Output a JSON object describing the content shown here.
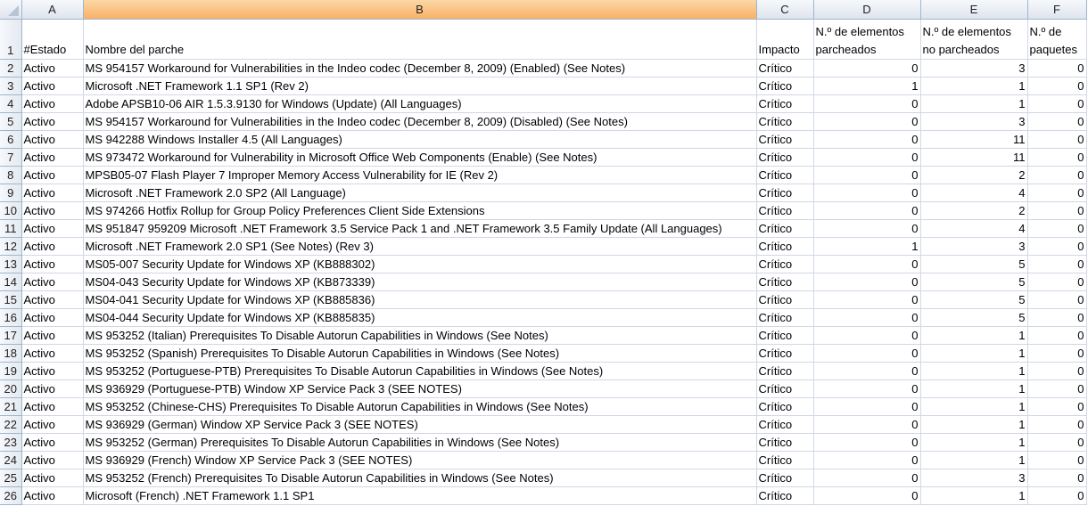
{
  "columns": [
    "A",
    "B",
    "C",
    "D",
    "E",
    "F"
  ],
  "header": {
    "row": "1",
    "estado": "#Estado",
    "nombre": "Nombre del parche",
    "impacto": "Impacto",
    "parcheados": "N.º de elementos parcheados",
    "no_parcheados": "N.º de elementos no parcheados",
    "paquetes": "N.º de paquetes"
  },
  "rows": [
    [
      "2",
      "Activo",
      "MS 954157 Workaround for Vulnerabilities in the Indeo codec (December 8, 2009) (Enabled) (See Notes)",
      "Crítico",
      "0",
      "3",
      "0"
    ],
    [
      "3",
      "Activo",
      "Microsoft .NET Framework 1.1 SP1 (Rev 2)",
      "Crítico",
      "1",
      "1",
      "0"
    ],
    [
      "4",
      "Activo",
      "Adobe APSB10-06 AIR 1.5.3.9130 for Windows (Update) (All Languages)",
      "Crítico",
      "0",
      "1",
      "0"
    ],
    [
      "5",
      "Activo",
      "MS 954157 Workaround for Vulnerabilities in the Indeo codec (December 8, 2009) (Disabled) (See Notes)",
      "Crítico",
      "0",
      "3",
      "0"
    ],
    [
      "6",
      "Activo",
      "MS 942288 Windows Installer 4.5 (All Languages)",
      "Crítico",
      "0",
      "11",
      "0"
    ],
    [
      "7",
      "Activo",
      "MS 973472 Workaround for Vulnerability in Microsoft Office Web Components (Enable) (See Notes)",
      "Crítico",
      "0",
      "11",
      "0"
    ],
    [
      "8",
      "Activo",
      "MPSB05-07 Flash Player 7 Improper Memory Access Vulnerability for IE (Rev 2)",
      "Crítico",
      "0",
      "2",
      "0"
    ],
    [
      "9",
      "Activo",
      "Microsoft .NET Framework 2.0 SP2 (All Language)",
      "Crítico",
      "0",
      "4",
      "0"
    ],
    [
      "10",
      "Activo",
      "MS 974266 Hotfix Rollup for Group Policy Preferences Client Side Extensions",
      "Crítico",
      "0",
      "2",
      "0"
    ],
    [
      "11",
      "Activo",
      "MS 951847 959209 Microsoft .NET Framework 3.5 Service Pack 1 and .NET Framework 3.5 Family Update (All Languages)",
      "Crítico",
      "0",
      "4",
      "0"
    ],
    [
      "12",
      "Activo",
      "Microsoft .NET Framework 2.0 SP1 (See Notes) (Rev 3)",
      "Crítico",
      "1",
      "3",
      "0"
    ],
    [
      "13",
      "Activo",
      "MS05-007 Security Update for Windows XP (KB888302)",
      "Crítico",
      "0",
      "5",
      "0"
    ],
    [
      "14",
      "Activo",
      "MS04-043 Security Update for Windows XP (KB873339)",
      "Crítico",
      "0",
      "5",
      "0"
    ],
    [
      "15",
      "Activo",
      "MS04-041 Security Update for Windows XP (KB885836)",
      "Crítico",
      "0",
      "5",
      "0"
    ],
    [
      "16",
      "Activo",
      "MS04-044 Security Update for Windows XP (KB885835)",
      "Crítico",
      "0",
      "5",
      "0"
    ],
    [
      "17",
      "Activo",
      "MS 953252 (Italian) Prerequisites To Disable Autorun Capabilities in Windows (See Notes)",
      "Crítico",
      "0",
      "1",
      "0"
    ],
    [
      "18",
      "Activo",
      "MS 953252 (Spanish) Prerequisites To Disable Autorun Capabilities in Windows (See Notes)",
      "Crítico",
      "0",
      "1",
      "0"
    ],
    [
      "19",
      "Activo",
      "MS 953252 (Portuguese-PTB) Prerequisites To Disable Autorun Capabilities in Windows (See Notes)",
      "Crítico",
      "0",
      "1",
      "0"
    ],
    [
      "20",
      "Activo",
      "MS 936929 (Portuguese-PTB) Window XP Service Pack 3 (SEE NOTES)",
      "Crítico",
      "0",
      "1",
      "0"
    ],
    [
      "21",
      "Activo",
      "MS 953252 (Chinese-CHS) Prerequisites To Disable Autorun Capabilities in Windows (See Notes)",
      "Crítico",
      "0",
      "1",
      "0"
    ],
    [
      "22",
      "Activo",
      "MS 936929 (German) Window XP Service Pack 3 (SEE NOTES)",
      "Crítico",
      "0",
      "1",
      "0"
    ],
    [
      "23",
      "Activo",
      "MS 953252 (German) Prerequisites To Disable Autorun Capabilities in Windows (See Notes)",
      "Crítico",
      "0",
      "1",
      "0"
    ],
    [
      "24",
      "Activo",
      "MS 936929 (French) Window XP Service Pack 3 (SEE NOTES)",
      "Crítico",
      "0",
      "1",
      "0"
    ],
    [
      "25",
      "Activo",
      "MS 953252 (French) Prerequisites To Disable Autorun Capabilities in Windows (See Notes)",
      "Crítico",
      "0",
      "3",
      "0"
    ],
    [
      "26",
      "Activo",
      "Microsoft (French) .NET Framework 1.1 SP1",
      "Crítico",
      "0",
      "1",
      "0"
    ]
  ]
}
